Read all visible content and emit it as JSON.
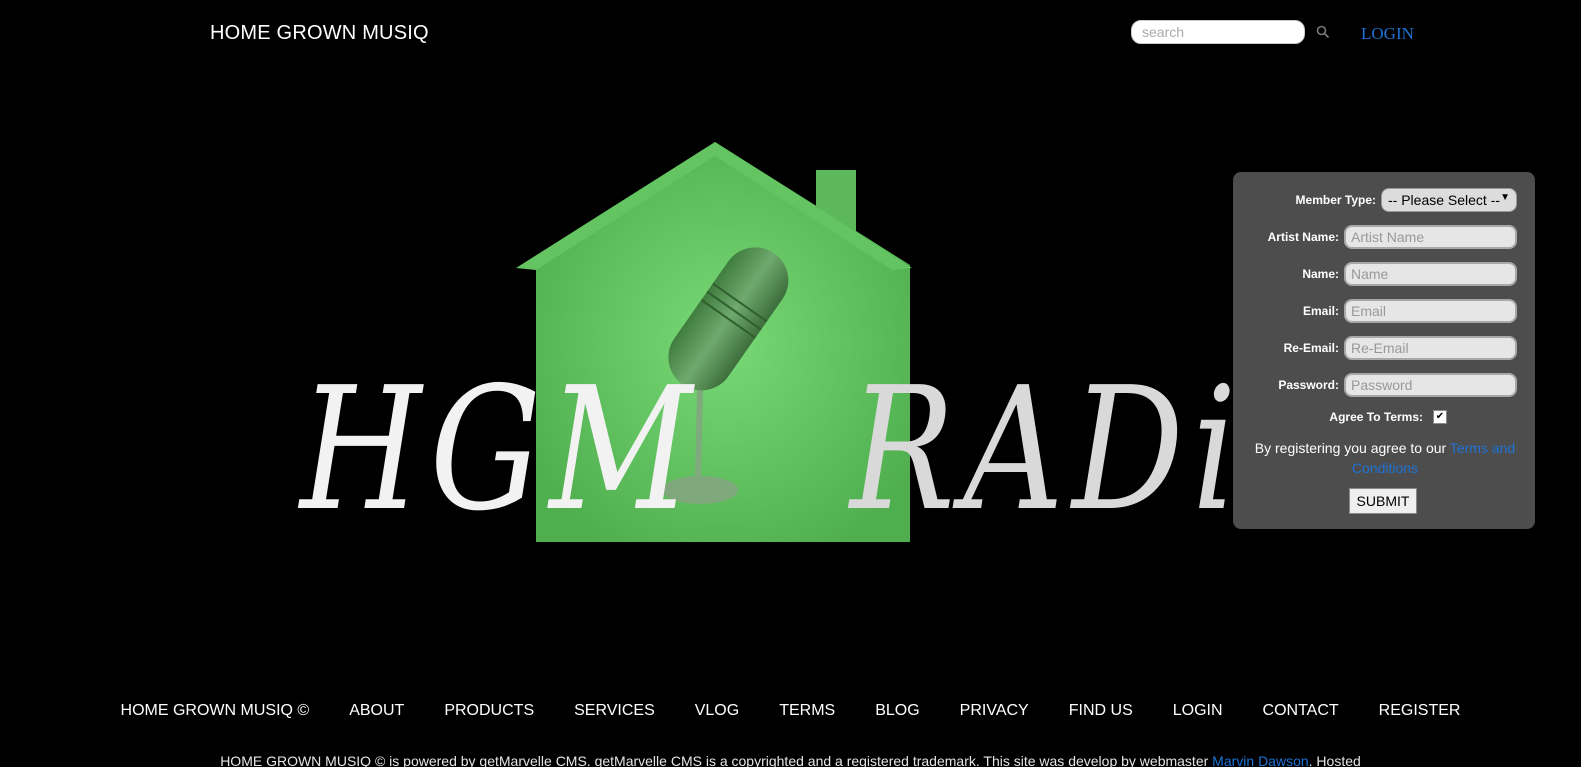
{
  "header": {
    "title": "HOME GROWN MUSIQ",
    "search_placeholder": "search",
    "login_label": "LOGIN"
  },
  "hero": {
    "logo_left_text": "HGM",
    "logo_right_text": "RADiO",
    "house_color": "#5cbf5a"
  },
  "registration": {
    "member_type_label": "Member Type:",
    "member_type_selected": "-- Please Select --",
    "artist_name_label": "Artist Name:",
    "artist_name_placeholder": "Artist Name",
    "name_label": "Name:",
    "name_placeholder": "Name",
    "email_label": "Email:",
    "email_placeholder": "Email",
    "re_email_label": "Re-Email:",
    "re_email_placeholder": "Re-Email",
    "password_label": "Password:",
    "password_placeholder": "Password",
    "agree_label": "Agree To Terms:",
    "agree_checked": true,
    "note_prefix": "By registering you agree to our ",
    "note_link": "Terms and Conditions",
    "submit_label": "SUBMIT"
  },
  "footer": {
    "nav": [
      "HOME GROWN MUSIQ ©",
      "ABOUT",
      "PRODUCTS",
      "SERVICES",
      "VLOG",
      "TERMS",
      "BLOG",
      "PRIVACY",
      "FIND US",
      "LOGIN",
      "CONTACT",
      "REGISTER"
    ],
    "credit_text": "HOME GROWN MUSIQ © is powered by getMarvelle CMS. getMarvelle CMS is a copyrighted and a registered trademark. This site was develop by webmaster ",
    "credit_link": "Marvin Dawson",
    "credit_suffix": ". Hosted"
  },
  "colors": {
    "link": "#1e73d6",
    "panel": "#4d4d4d",
    "background": "#000000"
  }
}
